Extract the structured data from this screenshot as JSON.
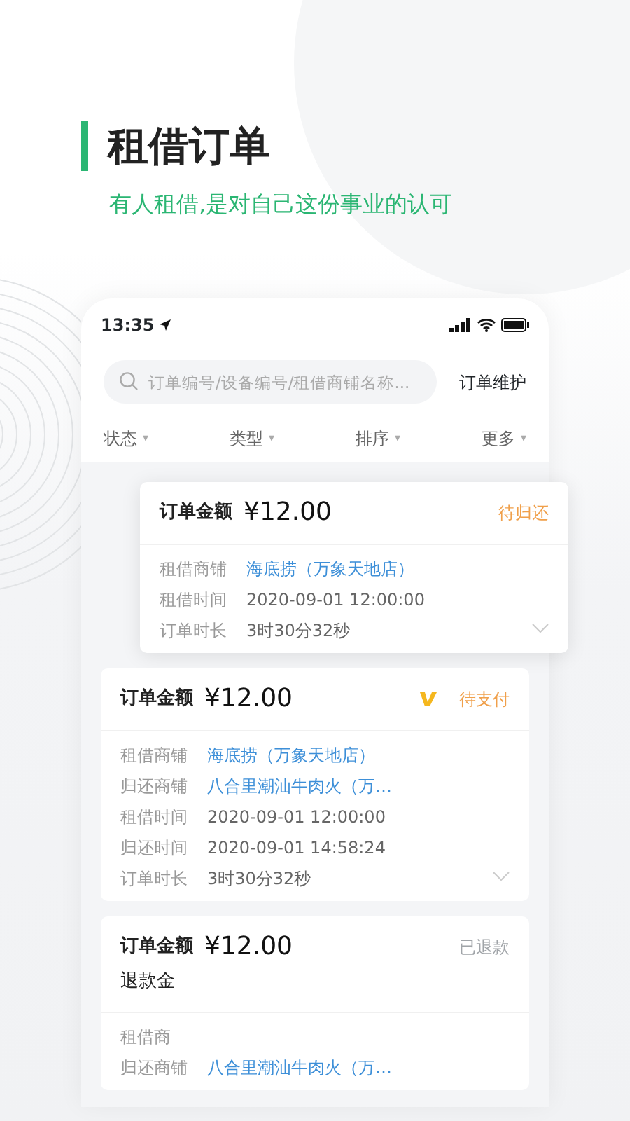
{
  "headline": {
    "title": "租借订单",
    "subtitle": "有人租借,是对自己这份事业的认可"
  },
  "status_bar": {
    "time": "13:35"
  },
  "search": {
    "placeholder": "订单编号/设备编号/租借商铺名称...",
    "action": "订单维护"
  },
  "filters": [
    {
      "label": "状态",
      "caret": "▾"
    },
    {
      "label": "类型",
      "caret": "▾"
    },
    {
      "label": "排序",
      "caret": "▾"
    },
    {
      "label": "更多",
      "caret": "▾"
    }
  ],
  "orders": [
    {
      "raised": true,
      "amount_label": "订单金额",
      "amount": "¥12.00",
      "status": "待归还",
      "color": "#f0a04b",
      "brand_mark": false,
      "rows": [
        {
          "label": "租借商铺",
          "value": "海底捞（万象天地店）",
          "kind": "link"
        },
        {
          "label": "租借时间",
          "value": "2020-09-01  12:00:00",
          "kind": "text"
        },
        {
          "label": "订单时长",
          "value": "3时30分32秒",
          "kind": "text"
        }
      ],
      "chevron": true
    },
    {
      "raised": false,
      "amount_label": "订单金额",
      "amount": "¥12.00",
      "status": "待支付",
      "color": "#f0a04b",
      "brand_mark": true,
      "rows": [
        {
          "label": "租借商铺",
          "value": "海底捞（万象天地店）",
          "kind": "link"
        },
        {
          "label": "归还商铺",
          "value": "八合里潮汕牛肉火（万…",
          "kind": "link"
        },
        {
          "label": "租借时间",
          "value": "2020-09-01  12:00:00",
          "kind": "text"
        },
        {
          "label": "归还时间",
          "value": "2020-09-01  14:58:24",
          "kind": "text"
        },
        {
          "label": "订单时长",
          "value": "3时30分32秒",
          "kind": "text"
        }
      ],
      "chevron": true
    },
    {
      "raised": false,
      "amount_label": "订单金额",
      "amount": "¥12.00",
      "status": "已退款",
      "color": "#a0a4a8",
      "brand_mark": false,
      "extra": [
        "退款金"
      ],
      "rows": [
        {
          "label": "租借商",
          "kind": "text"
        },
        {
          "label": "归还商铺",
          "value": "八合里潮汕牛肉火（万…",
          "kind": "link"
        }
      ],
      "chevron": false
    }
  ]
}
